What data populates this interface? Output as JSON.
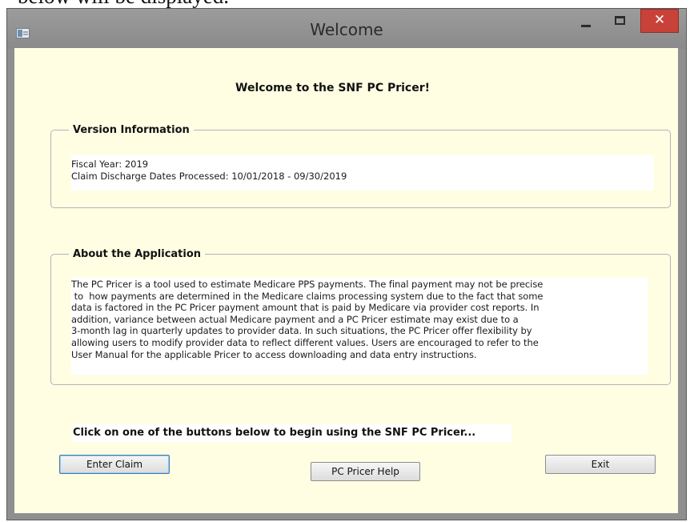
{
  "caption_text": "below will be displayed.",
  "window": {
    "title": "Welcome",
    "controls": {
      "minimize_icon": "minimize-icon",
      "maximize_icon": "maximize-icon",
      "close_label": "✕",
      "close_color": "#c9423a"
    }
  },
  "heading": "Welcome to the SNF PC Pricer!",
  "version_info": {
    "legend": "Version Information",
    "lines": [
      "Fiscal Year: 2019",
      "Claim Discharge Dates Processed: 10/01/2018 - 09/30/2019"
    ]
  },
  "about": {
    "legend": "About the Application",
    "lines": [
      "The PC Pricer is a tool used to estimate Medicare PPS payments.  The final payment may not be precise",
      " to  how payments are determined in the Medicare claims processing system due to the fact that some",
      "data is factored in the PC Pricer payment amount that is paid by Medicare via provider cost reports.  In",
      "addition, variance between actual Medicare payment and a PC Pricer estimate may exist due to a",
      "3-month lag in quarterly updates to provider data.  In such situations, the PC Pricer offer flexibility by",
      "allowing users to modify provider data to reflect different values.  Users are encouraged to refer to the",
      "User Manual for the applicable Pricer to access downloading and data entry instructions."
    ]
  },
  "instruction": "Click on one of the buttons below to begin using the SNF PC Pricer...",
  "buttons": {
    "enter_claim": "Enter Claim",
    "help": "PC Pricer Help",
    "exit": "Exit"
  },
  "colors": {
    "client_background": "#fffee3",
    "titlebar": "#8f8f8f",
    "focus_border": "#3c7fb1"
  }
}
